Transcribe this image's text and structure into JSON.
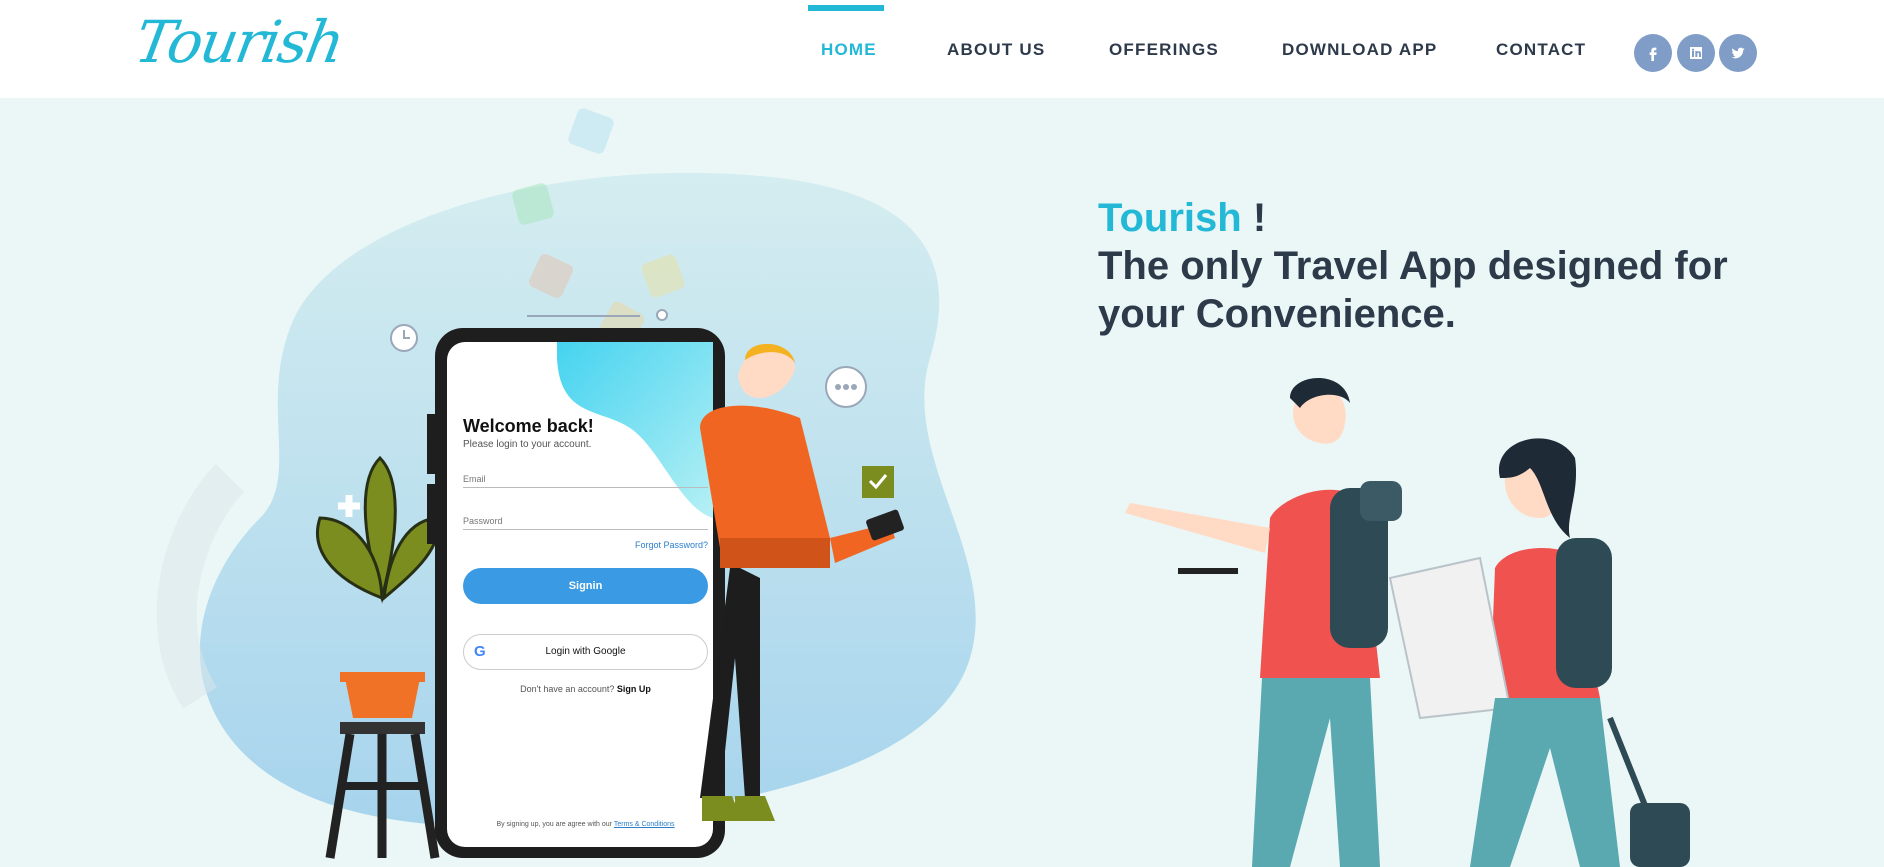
{
  "brand": {
    "logo_text": "Tourish"
  },
  "nav": {
    "items": [
      {
        "label": "HOME",
        "active": true
      },
      {
        "label": "ABOUT US",
        "active": false
      },
      {
        "label": "OFFERINGS",
        "active": false
      },
      {
        "label": "DOWNLOAD APP",
        "active": false
      },
      {
        "label": "CONTACT",
        "active": false
      }
    ],
    "social": [
      "facebook-icon",
      "linkedin-icon",
      "twitter-icon"
    ]
  },
  "hero": {
    "brand_word": "Tourish",
    "exclaim": " !",
    "tagline": "The only Travel App designed for your Convenience."
  },
  "phone": {
    "welcome": "Welcome back!",
    "subtitle": "Please login to your account.",
    "email_placeholder": "Email",
    "password_placeholder": "Password",
    "forgot": "Forgot Password?",
    "signin": "Signin",
    "google": "Login with Google",
    "no_account": "Don't have an account?",
    "signup": "Sign Up",
    "terms_prefix": "By signing up, you are agree with our",
    "terms_link": "Terms & Conditions"
  },
  "colors": {
    "accent": "#22b8d6",
    "text": "#2d3a4a",
    "social": "#7f9dc7",
    "button": "#3a9ae3"
  }
}
